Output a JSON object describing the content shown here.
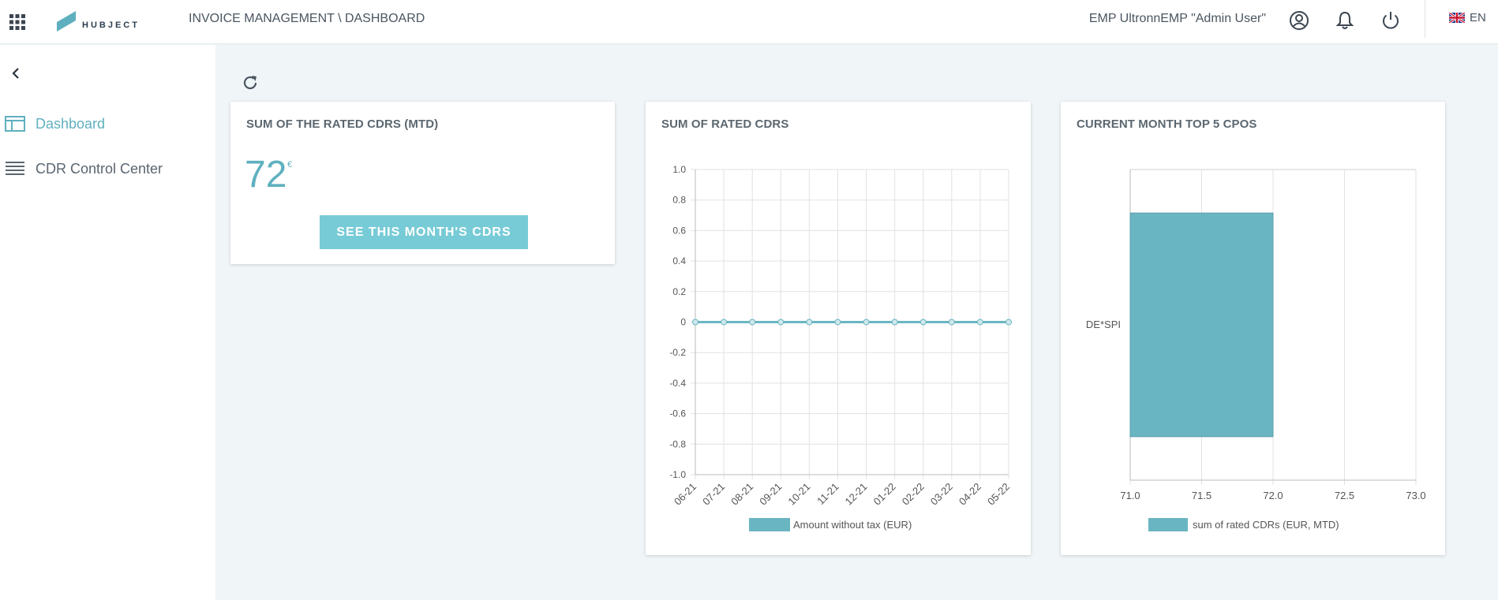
{
  "header": {
    "logo_text": "HUBJECT",
    "breadcrumb": "INVOICE MANAGEMENT \\ DASHBOARD",
    "user_name": "EMP UltronnEMP \"Admin User\"",
    "language": "EN"
  },
  "sidebar": {
    "items": [
      {
        "label": "Dashboard",
        "icon": "dashboard-icon",
        "active": true
      },
      {
        "label": "CDR Control Center",
        "icon": "list-icon",
        "active": false
      }
    ]
  },
  "cards": {
    "mtd": {
      "title": "SUM OF THE RATED CDRS (MTD)",
      "value": "72",
      "unit": "€",
      "button_label": "SEE THIS MONTH'S CDRS"
    },
    "line": {
      "title": "SUM OF RATED CDRS"
    },
    "bar": {
      "title": "CURRENT MONTH TOP 5 CPOS"
    }
  },
  "colors": {
    "accent": "#5fb0bf",
    "bar_fill": "#6ab5c2",
    "button": "#77cbd6"
  },
  "chart_data": [
    {
      "type": "line",
      "title": "SUM OF RATED CDRS",
      "categories": [
        "06-21",
        "07-21",
        "08-21",
        "09-21",
        "10-21",
        "11-21",
        "12-21",
        "01-22",
        "02-22",
        "03-22",
        "04-22",
        "05-22"
      ],
      "series": [
        {
          "name": "Amount without tax (EUR)",
          "values": [
            0,
            0,
            0,
            0,
            0,
            0,
            0,
            0,
            0,
            0,
            0,
            0
          ]
        }
      ],
      "ylim": [
        -1.0,
        1.0
      ],
      "yticks": [
        "1.0",
        "0.8",
        "0.6",
        "0.4",
        "0.2",
        "0",
        "-0.2",
        "-0.4",
        "-0.6",
        "-0.8",
        "-1.0"
      ],
      "grid": true,
      "legend": "bottom"
    },
    {
      "type": "bar",
      "orientation": "horizontal",
      "title": "CURRENT MONTH TOP 5 CPOS",
      "categories": [
        "DE*SPI"
      ],
      "series": [
        {
          "name": "sum of rated CDRs (EUR, MTD)",
          "values": [
            72
          ]
        }
      ],
      "xlim": [
        71.0,
        73.0
      ],
      "xticks": [
        "71.0",
        "71.5",
        "72.0",
        "72.5",
        "73.0"
      ],
      "grid": true,
      "legend": "bottom"
    }
  ]
}
